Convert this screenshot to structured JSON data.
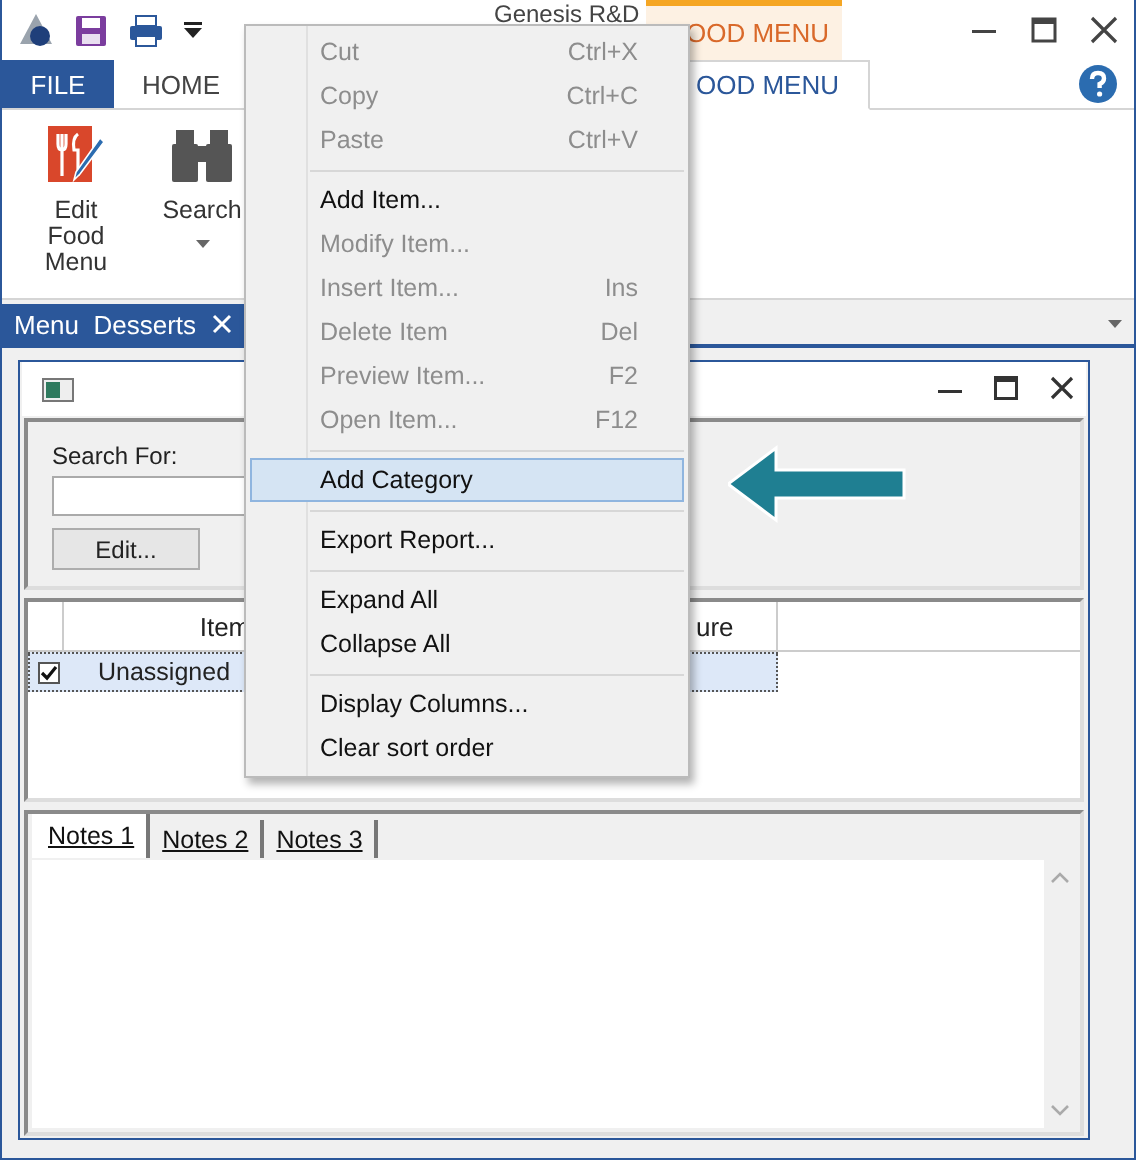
{
  "window": {
    "title": "Genesis R&D",
    "contextual_tab": "OOD MENU"
  },
  "ribbon_tabs": [
    {
      "label": "FILE",
      "kind": "file",
      "selected": false
    },
    {
      "label": "HOME",
      "kind": "tab",
      "selected": false
    },
    {
      "label": "OOD MENU",
      "kind": "tab",
      "selected": true
    }
  ],
  "ribbon_buttons": [
    {
      "label": "Edit\nFood Menu",
      "kind": "edit",
      "dropdown": false
    },
    {
      "label": "Search",
      "kind": "search",
      "dropdown": true
    }
  ],
  "document_tabs": [
    {
      "label": "Menu  Desserts",
      "selected": true
    }
  ],
  "child_window": {
    "search_label": "Search For:",
    "edit_button": "Edit...",
    "grid": {
      "columns": [
        {
          "label": "Item"
        },
        {
          "label": "ure"
        }
      ],
      "rows": [
        {
          "checked": true,
          "selected": true,
          "cells": [
            "Unassigned"
          ]
        }
      ]
    },
    "notes_tabs": [
      {
        "label": "Notes 1",
        "selected": true
      },
      {
        "label": "Notes 2",
        "selected": false
      },
      {
        "label": "Notes 3",
        "selected": false
      }
    ]
  },
  "context_menu": [
    {
      "kind": "item",
      "label": "Cut",
      "shortcut": "Ctrl+X",
      "disabled": true,
      "selected": false
    },
    {
      "kind": "item",
      "label": "Copy",
      "shortcut": "Ctrl+C",
      "disabled": true,
      "selected": false
    },
    {
      "kind": "item",
      "label": "Paste",
      "shortcut": "Ctrl+V",
      "disabled": true,
      "selected": false
    },
    {
      "kind": "separator"
    },
    {
      "kind": "item",
      "label": "Add Item...",
      "disabled": false,
      "selected": false
    },
    {
      "kind": "item",
      "label": "Modify Item...",
      "disabled": true,
      "selected": false
    },
    {
      "kind": "item",
      "label": "Insert Item...",
      "shortcut": "Ins",
      "disabled": true,
      "selected": false
    },
    {
      "kind": "item",
      "label": "Delete Item",
      "shortcut": "Del",
      "disabled": true,
      "selected": false
    },
    {
      "kind": "item",
      "label": "Preview Item...",
      "shortcut": "F2",
      "disabled": true,
      "selected": false
    },
    {
      "kind": "item",
      "label": "Open Item...",
      "shortcut": "F12",
      "disabled": true,
      "selected": false
    },
    {
      "kind": "separator"
    },
    {
      "kind": "item",
      "label": "Add Category",
      "disabled": false,
      "selected": true
    },
    {
      "kind": "separator"
    },
    {
      "kind": "item",
      "label": "Export Report...",
      "disabled": false,
      "selected": false
    },
    {
      "kind": "separator"
    },
    {
      "kind": "item",
      "label": "Expand All",
      "disabled": false,
      "selected": false
    },
    {
      "kind": "item",
      "label": "Collapse All",
      "disabled": false,
      "selected": false
    },
    {
      "kind": "separator"
    },
    {
      "kind": "item",
      "label": "Display Columns...",
      "disabled": false,
      "selected": false
    },
    {
      "kind": "item",
      "label": "Clear sort order",
      "disabled": false,
      "selected": false
    }
  ]
}
